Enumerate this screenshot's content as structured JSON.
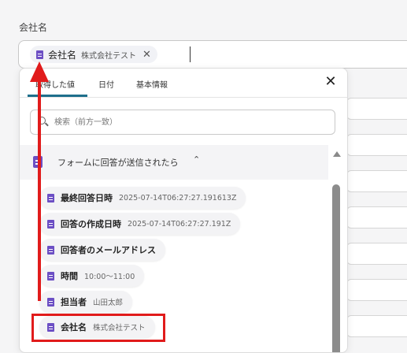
{
  "field": {
    "label": "会社名",
    "chip": {
      "name": "会社名",
      "value": "株式会社テスト",
      "remove": "✕"
    }
  },
  "panel": {
    "tabs": [
      "取得した値",
      "日付",
      "基本情報"
    ],
    "active_tab": 0,
    "close": "✕",
    "search_placeholder": "検索（前方一致）",
    "section": {
      "title": "フォームに回答が送信されたら",
      "chevron": "⌃"
    },
    "items": [
      {
        "name": "最終回答日時",
        "value": "2025-07-14T06:27:27.191613Z"
      },
      {
        "name": "回答の作成日時",
        "value": "2025-07-14T06:27:27.191Z"
      },
      {
        "name": "回答者のメールアドレス",
        "value": ""
      },
      {
        "name": "時間",
        "value": "10:00〜11:00"
      },
      {
        "name": "担当者",
        "value": "山田太郎"
      },
      {
        "name": "会社名",
        "value": "株式会社テスト"
      }
    ]
  },
  "colors": {
    "accent": "#1e6f8c",
    "annotation": "#e11b1b",
    "doc_icon": "#6c4fc4"
  }
}
